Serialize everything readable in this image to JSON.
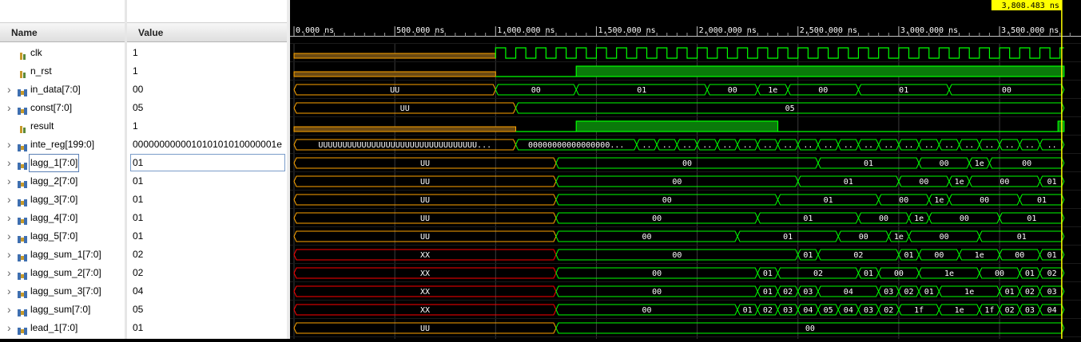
{
  "headers": {
    "name": "Name",
    "value": "Value"
  },
  "cursor_label": "3,808.483 ns",
  "time_axis": {
    "unit": "ns",
    "labels": [
      "0.000 ns",
      "500.000 ns",
      "1,000.000 ns",
      "1,500.000 ns",
      "2,000.000 ns",
      "2,500.000 ns",
      "3,000.000 ns",
      "3,500.000 ns"
    ]
  },
  "colors": {
    "wave": "#00ff00",
    "undefined": "#ffa500",
    "unknown": "#ff0000",
    "cursor": "#ffff00",
    "background": "#000000"
  },
  "signals": [
    {
      "name": "clk",
      "value": "1",
      "kind": "bit",
      "expandable": false
    },
    {
      "name": "n_rst",
      "value": "1",
      "kind": "bit",
      "expandable": false
    },
    {
      "name": "in_data[7:0]",
      "value": "00",
      "kind": "bus",
      "expandable": true
    },
    {
      "name": "const[7:0]",
      "value": "05",
      "kind": "bus",
      "expandable": true
    },
    {
      "name": "result",
      "value": "1",
      "kind": "bit",
      "expandable": false
    },
    {
      "name": "inte_reg[199:0]",
      "value": "000000000001010101010000001e",
      "kind": "bus",
      "expandable": true
    },
    {
      "name": "lagg_1[7:0]",
      "value": "01",
      "kind": "bus",
      "expandable": true,
      "selected": true
    },
    {
      "name": "lagg_2[7:0]",
      "value": "01",
      "kind": "bus",
      "expandable": true
    },
    {
      "name": "lagg_3[7:0]",
      "value": "01",
      "kind": "bus",
      "expandable": true
    },
    {
      "name": "lagg_4[7:0]",
      "value": "01",
      "kind": "bus",
      "expandable": true
    },
    {
      "name": "lagg_5[7:0]",
      "value": "01",
      "kind": "bus",
      "expandable": true
    },
    {
      "name": "lagg_sum_1[7:0]",
      "value": "02",
      "kind": "bus",
      "expandable": true
    },
    {
      "name": "lagg_sum_2[7:0]",
      "value": "02",
      "kind": "bus",
      "expandable": true
    },
    {
      "name": "lagg_sum_3[7:0]",
      "value": "04",
      "kind": "bus",
      "expandable": true
    },
    {
      "name": "lagg_sum[7:0]",
      "value": "05",
      "kind": "bus",
      "expandable": true
    },
    {
      "name": "lead_1[7:0]",
      "value": "01",
      "kind": "bus",
      "expandable": true
    }
  ],
  "waves": [
    {
      "type": "clock",
      "pre_state": "U",
      "pre_end_ns": 1000,
      "period_ns": 100
    },
    {
      "type": "bit",
      "segs": [
        [
          "U",
          0,
          1000
        ],
        [
          "0",
          1000,
          1400
        ],
        [
          "1",
          1400,
          3820
        ]
      ]
    },
    {
      "type": "bus",
      "segs": [
        [
          "UU",
          0,
          1000,
          "U"
        ],
        [
          "00",
          1000,
          1400
        ],
        [
          "01",
          1400,
          2050
        ],
        [
          "00",
          2050,
          2300
        ],
        [
          "1e",
          2300,
          2450
        ],
        [
          "00",
          2450,
          2800
        ],
        [
          "01",
          2800,
          3250
        ],
        [
          "00",
          3250,
          3820
        ]
      ]
    },
    {
      "type": "bus",
      "segs": [
        [
          "UU",
          0,
          1100,
          "U"
        ],
        [
          "05",
          1100,
          3820
        ]
      ]
    },
    {
      "type": "bit",
      "segs": [
        [
          "U",
          0,
          1100
        ],
        [
          "0",
          1100,
          1400
        ],
        [
          "1",
          1400,
          2400
        ],
        [
          "0",
          2400,
          3790
        ],
        [
          "1",
          3790,
          3820
        ]
      ]
    },
    {
      "type": "bus",
      "segs": [
        [
          "UUUUUUUUUUUUUUUUUUUUUUUUUUUUUUUUU...",
          0,
          1100,
          "U"
        ],
        [
          "00000000000000000...",
          1100,
          1700
        ],
        [
          "..",
          1700,
          1800
        ],
        [
          "..",
          1800,
          1900
        ],
        [
          "..",
          1900,
          2000
        ],
        [
          "..",
          2000,
          2100
        ],
        [
          "..",
          2100,
          2200
        ],
        [
          "..",
          2200,
          2300
        ],
        [
          "..",
          2300,
          2400
        ],
        [
          "..",
          2400,
          2500
        ],
        [
          "..",
          2500,
          2600
        ],
        [
          "..",
          2600,
          2700
        ],
        [
          "..",
          2700,
          2800
        ],
        [
          "..",
          2800,
          2900
        ],
        [
          "..",
          2900,
          3000
        ],
        [
          "..",
          3000,
          3100
        ],
        [
          "..",
          3100,
          3200
        ],
        [
          "..",
          3200,
          3300
        ],
        [
          "..",
          3300,
          3400
        ],
        [
          "..",
          3400,
          3500
        ],
        [
          "..",
          3500,
          3600
        ],
        [
          "..",
          3600,
          3700
        ],
        [
          "..",
          3700,
          3820
        ]
      ]
    },
    {
      "type": "bus",
      "segs": [
        [
          "UU",
          0,
          1300,
          "U"
        ],
        [
          "00",
          1300,
          2600
        ],
        [
          "01",
          2600,
          3100
        ],
        [
          "00",
          3100,
          3350
        ],
        [
          "1e",
          3350,
          3450
        ],
        [
          "00",
          3450,
          3820
        ]
      ]
    },
    {
      "type": "bus",
      "segs": [
        [
          "UU",
          0,
          1300,
          "U"
        ],
        [
          "00",
          1300,
          2500
        ],
        [
          "01",
          2500,
          3000
        ],
        [
          "00",
          3000,
          3250
        ],
        [
          "1e",
          3250,
          3350
        ],
        [
          "00",
          3350,
          3700
        ],
        [
          "01",
          3700,
          3820
        ]
      ]
    },
    {
      "type": "bus",
      "segs": [
        [
          "UU",
          0,
          1300,
          "U"
        ],
        [
          "00",
          1300,
          2400
        ],
        [
          "01",
          2400,
          2900
        ],
        [
          "00",
          2900,
          3150
        ],
        [
          "1e",
          3150,
          3250
        ],
        [
          "00",
          3250,
          3600
        ],
        [
          "01",
          3600,
          3820
        ]
      ]
    },
    {
      "type": "bus",
      "segs": [
        [
          "UU",
          0,
          1300,
          "U"
        ],
        [
          "00",
          1300,
          2300
        ],
        [
          "01",
          2300,
          2800
        ],
        [
          "00",
          2800,
          3050
        ],
        [
          "1e",
          3050,
          3150
        ],
        [
          "00",
          3150,
          3500
        ],
        [
          "01",
          3500,
          3820
        ]
      ]
    },
    {
      "type": "bus",
      "segs": [
        [
          "UU",
          0,
          1300,
          "U"
        ],
        [
          "00",
          1300,
          2200
        ],
        [
          "01",
          2200,
          2700
        ],
        [
          "00",
          2700,
          2950
        ],
        [
          "1e",
          2950,
          3050
        ],
        [
          "00",
          3050,
          3400
        ],
        [
          "01",
          3400,
          3820
        ]
      ]
    },
    {
      "type": "bus",
      "segs": [
        [
          "XX",
          0,
          1300,
          "X"
        ],
        [
          "00",
          1300,
          2500
        ],
        [
          "01",
          2500,
          2600
        ],
        [
          "02",
          2600,
          3000
        ],
        [
          "01",
          3000,
          3100
        ],
        [
          "00",
          3100,
          3300
        ],
        [
          "1e",
          3300,
          3500
        ],
        [
          "00",
          3500,
          3700
        ],
        [
          "01",
          3700,
          3820
        ]
      ]
    },
    {
      "type": "bus",
      "segs": [
        [
          "XX",
          0,
          1300,
          "X"
        ],
        [
          "00",
          1300,
          2300
        ],
        [
          "01",
          2300,
          2400
        ],
        [
          "02",
          2400,
          2800
        ],
        [
          "01",
          2800,
          2900
        ],
        [
          "00",
          2900,
          3100
        ],
        [
          "1e",
          3100,
          3400
        ],
        [
          "00",
          3400,
          3600
        ],
        [
          "01",
          3600,
          3700
        ],
        [
          "02",
          3700,
          3820
        ]
      ]
    },
    {
      "type": "bus",
      "segs": [
        [
          "XX",
          0,
          1300,
          "X"
        ],
        [
          "00",
          1300,
          2300
        ],
        [
          "01",
          2300,
          2400
        ],
        [
          "02",
          2400,
          2500
        ],
        [
          "03",
          2500,
          2600
        ],
        [
          "04",
          2600,
          2900
        ],
        [
          "03",
          2900,
          3000
        ],
        [
          "02",
          3000,
          3100
        ],
        [
          "01",
          3100,
          3200
        ],
        [
          "1e",
          3200,
          3500
        ],
        [
          "01",
          3500,
          3600
        ],
        [
          "02",
          3600,
          3700
        ],
        [
          "03",
          3700,
          3820
        ]
      ]
    },
    {
      "type": "bus",
      "segs": [
        [
          "XX",
          0,
          1300,
          "X"
        ],
        [
          "00",
          1300,
          2200
        ],
        [
          "01",
          2200,
          2300
        ],
        [
          "02",
          2300,
          2400
        ],
        [
          "03",
          2400,
          2500
        ],
        [
          "04",
          2500,
          2600
        ],
        [
          "05",
          2600,
          2700
        ],
        [
          "04",
          2700,
          2800
        ],
        [
          "03",
          2800,
          2900
        ],
        [
          "02",
          2900,
          3000
        ],
        [
          "1f",
          3000,
          3200
        ],
        [
          "1e",
          3200,
          3400
        ],
        [
          "1f",
          3400,
          3500
        ],
        [
          "02",
          3500,
          3600
        ],
        [
          "03",
          3600,
          3700
        ],
        [
          "04",
          3700,
          3820
        ]
      ]
    },
    {
      "type": "bus",
      "segs": [
        [
          "UU",
          0,
          1300,
          "U"
        ],
        [
          "00",
          1300,
          3820
        ]
      ]
    }
  ]
}
